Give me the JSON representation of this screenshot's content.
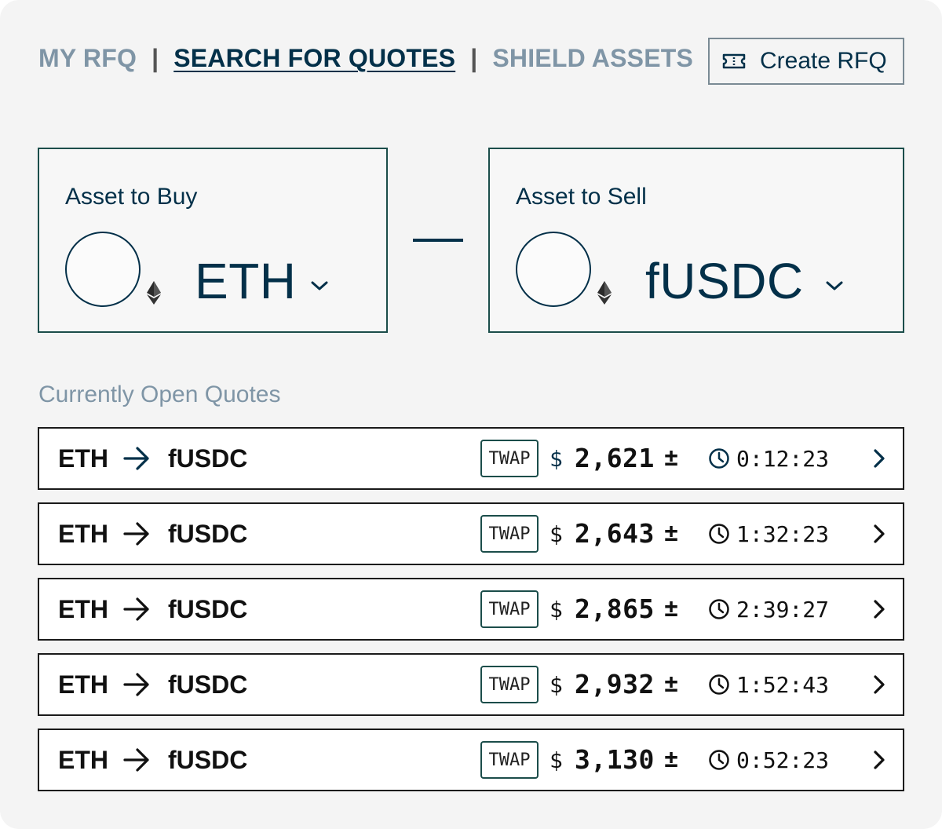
{
  "nav": {
    "tabs": [
      {
        "label": "MY RFQ",
        "active": false
      },
      {
        "label": "SEARCH FOR QUOTES",
        "active": true
      },
      {
        "label": "SHIELD ASSETS",
        "active": false
      }
    ],
    "separator": "|"
  },
  "create_button": {
    "label": "Create RFQ",
    "icon": "ticket-icon"
  },
  "buy": {
    "label": "Asset to Buy",
    "symbol": "ETH",
    "icon": "ethereum-icon"
  },
  "sell": {
    "label": "Asset to Sell",
    "symbol": "fUSDC",
    "icon": "ethereum-icon"
  },
  "quotes_title": "Currently Open Quotes",
  "quotes": [
    {
      "from": "ETH",
      "to": "fUSDC",
      "type": "TWAP",
      "currency": "$",
      "price": "2,621",
      "pm": "±",
      "time": "0:12:23"
    },
    {
      "from": "ETH",
      "to": "fUSDC",
      "type": "TWAP",
      "currency": "$",
      "price": "2,643",
      "pm": "±",
      "time": "1:32:23"
    },
    {
      "from": "ETH",
      "to": "fUSDC",
      "type": "TWAP",
      "currency": "$",
      "price": "2,865",
      "pm": "±",
      "time": "2:39:27"
    },
    {
      "from": "ETH",
      "to": "fUSDC",
      "type": "TWAP",
      "currency": "$",
      "price": "2,932",
      "pm": "±",
      "time": "1:52:43"
    },
    {
      "from": "ETH",
      "to": "fUSDC",
      "type": "TWAP",
      "currency": "$",
      "price": "3,130",
      "pm": "±",
      "time": "0:52:23"
    }
  ],
  "colors": {
    "accent": "#033049",
    "muted": "#7f95a6",
    "border": "#1b4d4a"
  }
}
